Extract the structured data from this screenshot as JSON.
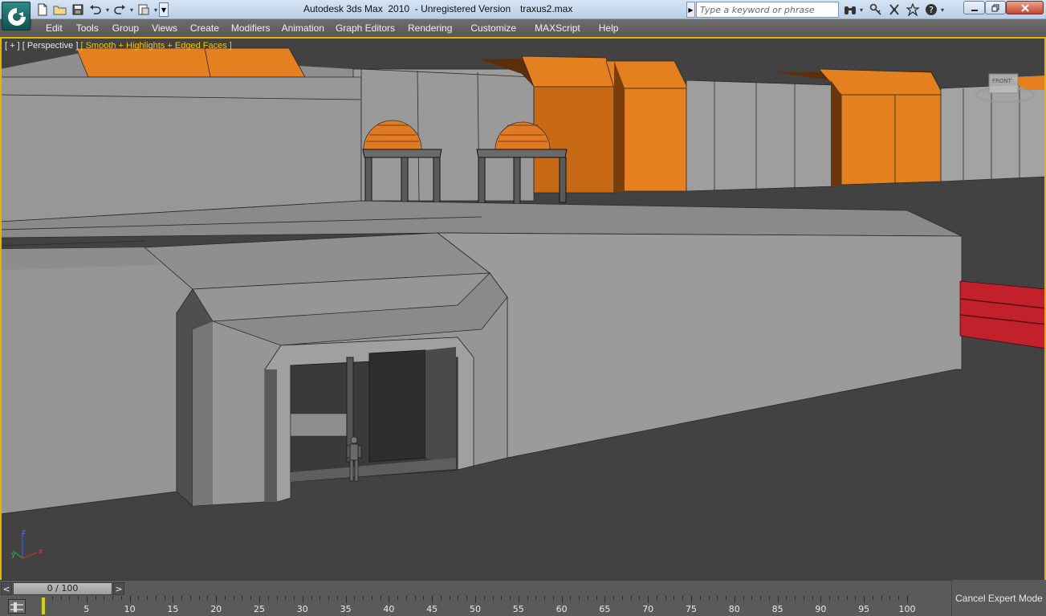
{
  "app": {
    "title": "Autodesk 3ds Max  2010  - Unregistered Version",
    "filename": "traxus2.max",
    "logo_icon": "3dsmax-logo-icon"
  },
  "quick_access": {
    "icons": [
      "new-file-icon",
      "open-folder-icon",
      "save-icon",
      "undo-icon",
      "redo-icon",
      "project-folder-icon"
    ]
  },
  "search": {
    "placeholder": "Type a keyword or phrase"
  },
  "info_center": {
    "icons": [
      "binoculars-icon",
      "key-icon",
      "communication-center-icon",
      "star-icon",
      "help-icon"
    ]
  },
  "window_controls": [
    "minimize-icon",
    "restore-icon",
    "close-icon"
  ],
  "menu": [
    "Edit",
    "Tools",
    "Group",
    "Views",
    "Create",
    "Modifiers",
    "Animation",
    "Graph Editors",
    "Rendering",
    "Customize",
    "MAXScript",
    "Help"
  ],
  "viewport": {
    "label_plus": "[ + ]",
    "label_view": "[ Perspective ]",
    "label_shading": "[ Smooth + Highlights + Edged Faces ]",
    "viewcube_face": "FRONT",
    "axis_labels": [
      "z",
      "x",
      "y"
    ]
  },
  "timeline": {
    "slider_text": "0 / 100",
    "prev_label": "<",
    "next_label": ">",
    "ticks": [
      5,
      10,
      15,
      20,
      25,
      30,
      35,
      40,
      45,
      50,
      55,
      60,
      65,
      70,
      75,
      80,
      85,
      90,
      95,
      100
    ]
  },
  "status": {
    "cancel_expert_mode": "Cancel Expert Mode"
  },
  "colors": {
    "viewport_bg": "#424242",
    "active_border": "#e8b200",
    "orange_block": "#e8821c",
    "gray_wall": "#9a9a9a"
  }
}
